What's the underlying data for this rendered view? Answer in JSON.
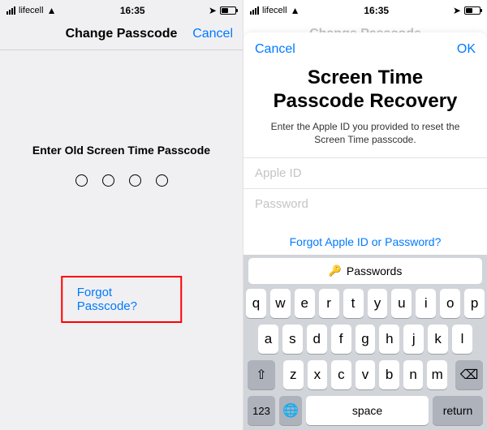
{
  "statusbar": {
    "carrier": "lifecell",
    "time": "16:35"
  },
  "left": {
    "nav_title": "Change Passcode",
    "cancel": "Cancel",
    "prompt": "Enter Old Screen Time Passcode",
    "forgot": "Forgot Passcode?"
  },
  "right": {
    "faded_title": "Change Passcode",
    "cancel": "Cancel",
    "ok": "OK",
    "title_line1": "Screen Time",
    "title_line2": "Passcode Recovery",
    "subtitle": "Enter the Apple ID you provided to reset the Screen Time passcode.",
    "field_appleid": "Apple ID",
    "field_password": "Password",
    "forgot_apple": "Forgot Apple ID or Password?"
  },
  "keyboard": {
    "passwords": "Passwords",
    "row1": [
      "q",
      "w",
      "e",
      "r",
      "t",
      "y",
      "u",
      "i",
      "o",
      "p"
    ],
    "row2": [
      "a",
      "s",
      "d",
      "f",
      "g",
      "h",
      "j",
      "k",
      "l"
    ],
    "row3": [
      "z",
      "x",
      "c",
      "v",
      "b",
      "n",
      "m"
    ],
    "numkey": "123",
    "space": "space",
    "return": "return"
  }
}
